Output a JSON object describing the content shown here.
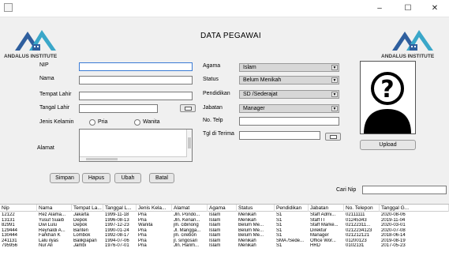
{
  "window": {
    "minimize": "–",
    "maximize": "☐",
    "close": "✕"
  },
  "logo_text": "ANDALUS INSTITUTE",
  "heading": "DATA PEGAWAI",
  "form": {
    "nip_label": "NIP",
    "nip_value": "",
    "nama_label": "Nama",
    "nama_value": "",
    "tempat_lahir_label": "Tempat Lahir",
    "tempat_lahir_value": "",
    "tanggal_lahir_label": "Tangal Lahir",
    "tanggal_lahir_value": "",
    "jenis_kelamin_label": "Jenis Kelamin",
    "radio_pria": "Pria",
    "radio_wanita": "Wanita",
    "alamat_label": "Alamat",
    "alamat_value": "",
    "agama_label": "Agama",
    "agama_value": "Islam",
    "status_label": "Status",
    "status_value": "Belum Menikah",
    "pendidikan_label": "Pendidikan",
    "pendidikan_value": "SD /Sederajat",
    "jabatan_label": "Jabatan",
    "jabatan_value": "Manager",
    "no_telp_label": "No. Telp",
    "no_telp_value": "",
    "tgl_terima_label": "Tgl di Terima",
    "tgl_terima_value": ""
  },
  "buttons": {
    "simpan": "Simpan",
    "hapus": "Hapus",
    "ubah": "Ubah",
    "batal": "Batal",
    "upload": "Upload"
  },
  "search": {
    "label": "Cari Nip",
    "value": ""
  },
  "table": {
    "headers": [
      "Nip",
      "Nama",
      "Tempat La...",
      "Tanggal L...",
      "Jenis Kela...",
      "Alamat",
      "Agama",
      "Status",
      "Pendidikan",
      "Jabatan",
      "No. Telepon",
      "Tanggal G..."
    ],
    "rows": [
      [
        "12122",
        "Rez Alama...",
        "Jakarta",
        "1999-11-18",
        "Pria",
        "Jln. Pondo...",
        "Islam",
        "Menikah",
        "S1",
        "Staff Admi...",
        "02111111",
        "2020-08-06"
      ],
      [
        "13131",
        "Yusuf Suaib",
        "Depok",
        "1996-08-13",
        "Pria",
        "Jln. Kenan...",
        "Islam",
        "Menikah",
        "S1",
        "Staff IT",
        "01245343",
        "2019-11-04"
      ],
      [
        "82991",
        "Dwi Lulu",
        "Depok",
        "1997-12-23",
        "Wanita",
        "jln. cibinong",
        "Islam",
        "Belum Me...",
        "S1",
        "Staff Marke...",
        "02122311...",
        "2020-03-01"
      ],
      [
        "129444",
        "Reynaldi A...",
        "Banten",
        "1990-01-24",
        "Pria",
        "Jl. Mangga...",
        "Islam",
        "Belum Me...",
        "S1",
        "Direktur",
        "0212234123",
        "2020-07-08"
      ],
      [
        "130444",
        "Farkhan K",
        "Lombok",
        "1992-08-17",
        "Pria",
        "jln. cirebon",
        "Islam",
        "Belum Me...",
        "S1",
        "Manager",
        "021212121",
        "2018-06-14"
      ],
      [
        "241131",
        "Lalu ilyas",
        "Balikpapan",
        "1994-07-06",
        "Pria",
        "jl. singosari",
        "Islam",
        "Menikah",
        "SMA /Sede...",
        "Office Wor...",
        "01200123",
        "2019-08-19"
      ],
      [
        "795956",
        "Nur Ali",
        "Jambi",
        "1976-07-01",
        "Pria",
        "Jln. Harim...",
        "Islam",
        "Menikah",
        "S1",
        "HRD",
        "0102131",
        "2017-05-23"
      ]
    ]
  },
  "colors": {
    "logo_blue": "#2f5f9e",
    "logo_teal": "#3aa7c9",
    "focus": "#3a7bd5"
  }
}
